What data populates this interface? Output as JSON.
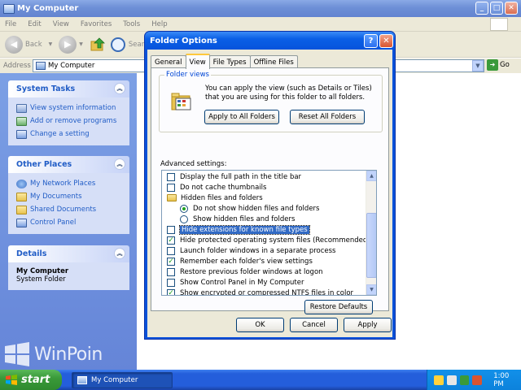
{
  "explorer": {
    "title": "My Computer",
    "menu": [
      "File",
      "Edit",
      "View",
      "Favorites",
      "Tools",
      "Help"
    ],
    "toolbar": {
      "back_label": "Back",
      "search_label": "Search"
    },
    "address": {
      "label": "Address",
      "value": "My Computer",
      "go_label": "Go"
    }
  },
  "sidebar": {
    "system_tasks": {
      "title": "System Tasks",
      "items": [
        "View system information",
        "Add or remove programs",
        "Change a setting"
      ]
    },
    "other_places": {
      "title": "Other Places",
      "items": [
        "My Network Places",
        "My Documents",
        "Shared Documents",
        "Control Panel"
      ]
    },
    "details": {
      "title": "Details",
      "name": "My Computer",
      "desc": "System Folder"
    }
  },
  "dialog": {
    "title": "Folder Options",
    "tabs": [
      "General",
      "View",
      "File Types",
      "Offline Files"
    ],
    "active_tab": "View",
    "folder_views": {
      "label": "Folder views",
      "text": "You can apply the view (such as Details or Tiles) that you are using for this folder to all folders.",
      "apply_all": "Apply to All Folders",
      "reset_all": "Reset All Folders"
    },
    "advanced_label": "Advanced settings:",
    "settings": [
      {
        "kind": "checkbox",
        "label": "Display the full path in the title bar",
        "checked": false
      },
      {
        "kind": "checkbox",
        "label": "Do not cache thumbnails",
        "checked": false
      },
      {
        "kind": "folder",
        "label": "Hidden files and folders"
      },
      {
        "kind": "radio",
        "label": "Do not show hidden files and folders",
        "checked": true
      },
      {
        "kind": "radio",
        "label": "Show hidden files and folders",
        "checked": false
      },
      {
        "kind": "checkbox",
        "label": "Hide extensions for known file types",
        "checked": false,
        "selected": true
      },
      {
        "kind": "checkbox",
        "label": "Hide protected operating system files (Recommended)",
        "checked": true
      },
      {
        "kind": "checkbox",
        "label": "Launch folder windows in a separate process",
        "checked": false
      },
      {
        "kind": "checkbox",
        "label": "Remember each folder's view settings",
        "checked": true
      },
      {
        "kind": "checkbox",
        "label": "Restore previous folder windows at logon",
        "checked": false
      },
      {
        "kind": "checkbox",
        "label": "Show Control Panel in My Computer",
        "checked": false
      },
      {
        "kind": "checkbox",
        "label": "Show encrypted or compressed NTFS files in color",
        "checked": true
      }
    ],
    "restore_defaults": "Restore Defaults",
    "ok": "OK",
    "cancel": "Cancel",
    "apply": "Apply"
  },
  "taskbar": {
    "start": "start",
    "task": "My Computer",
    "clock": "1:00 PM"
  },
  "watermark": "WinPoin"
}
